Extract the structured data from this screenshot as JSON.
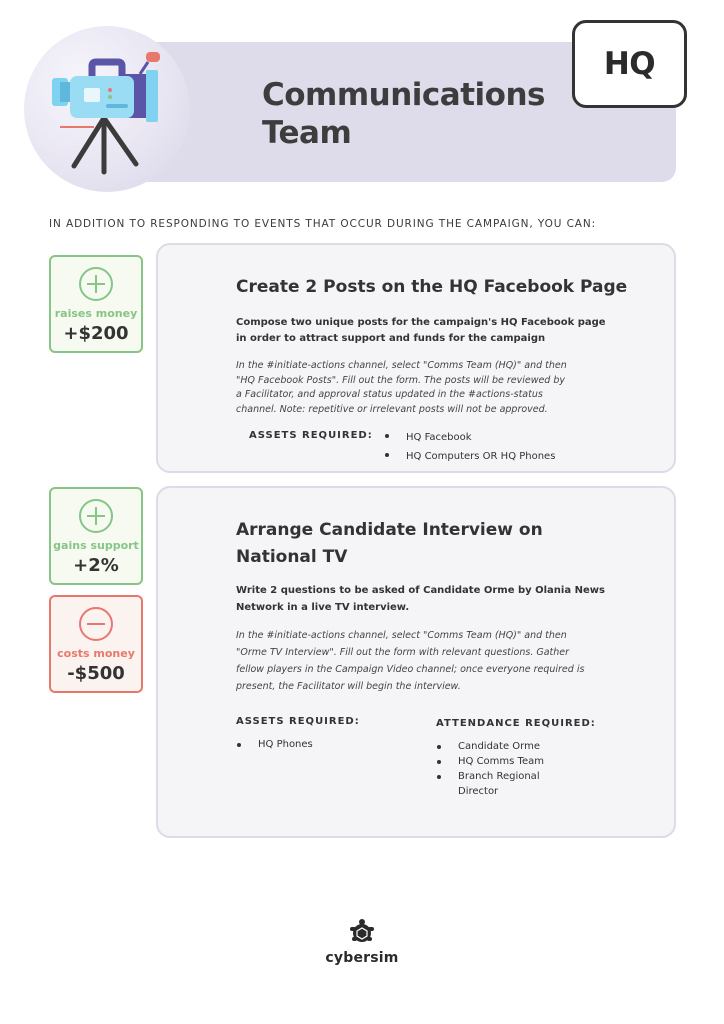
{
  "header": {
    "title_line1": "Communications",
    "title_line2": "Team",
    "badge": "HQ",
    "hero_icon": "video-camera-icon"
  },
  "intro": "IN ADDITION TO RESPONDING TO EVENTS THAT OCCUR DURING THE CAMPAIGN, YOU CAN:",
  "actions": [
    {
      "effects": [
        {
          "sign": "+",
          "label": "raises money",
          "amount": "+$200",
          "color": "#86c587"
        }
      ],
      "title": "Create 2 Posts on the HQ Facebook Page",
      "lead_line1": "Compose two unique posts for the campaign's HQ Facebook page",
      "lead_line2": "in order to attract support and funds for the campaign",
      "body_line1": "In the #initiate-actions channel, select \"Comms Team (HQ)\" and then",
      "body_line2": "\"HQ Facebook Posts\". Fill out the form. The posts will be reviewed by",
      "body_line3": "a Facilitator, and approval status updated in the #actions-status",
      "body_line4": "channel. Note: repetitive or irrelevant posts will not be approved.",
      "assets_label": "ASSETS REQUIRED:",
      "assets": [
        "HQ Facebook",
        "HQ Computers OR HQ Phones"
      ]
    },
    {
      "effects": [
        {
          "sign": "+",
          "label": "gains support",
          "amount": "+2%",
          "color": "#86c587"
        },
        {
          "sign": "-",
          "label": "costs money",
          "amount": "-$500",
          "color": "#e9786c"
        }
      ],
      "title_line1": "Arrange Candidate Interview on",
      "title_line2": "National TV",
      "lead_line1": "Write 2 questions to be asked of Candidate Orme by Olania News",
      "lead_line2": "Network in a live TV interview.",
      "body_line1": "In the #initiate-actions channel, select \"Comms Team (HQ)\" and then",
      "body_line2": "\"Orme TV Interview\". Fill out the form with relevant questions. Gather",
      "body_line3": "fellow players in the Campaign Video channel; once everyone required is",
      "body_line4": "present, the Facilitator will begin the interview.",
      "assets_label": "ASSETS REQUIRED:",
      "assets": [
        "HQ Phones"
      ],
      "attendance_label": "ATTENDANCE REQUIRED:",
      "attendance": [
        "Candidate Orme",
        "HQ Comms Team",
        "Branch Regional",
        "Director"
      ]
    }
  ],
  "footer": {
    "logo_text": "cybersim",
    "logo_icon": "turtle-icon"
  }
}
